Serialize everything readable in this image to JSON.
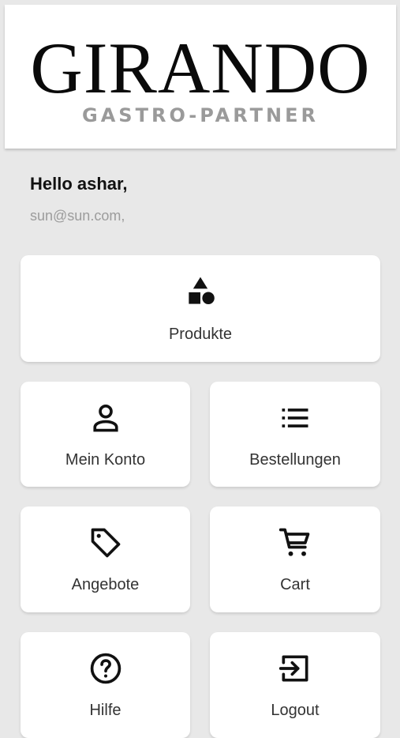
{
  "header": {
    "logo_main": "GIRANDO",
    "logo_sub": "GASTRO-PARTNER"
  },
  "user": {
    "greeting": "Hello ashar,",
    "email": "sun@sun.com,"
  },
  "menu": {
    "produkte": {
      "label": "Produkte",
      "icon": "shapes-icon"
    },
    "mein_konto": {
      "label": "Mein Konto",
      "icon": "person-icon"
    },
    "bestellungen": {
      "label": "Bestellungen",
      "icon": "list-icon"
    },
    "angebote": {
      "label": "Angebote",
      "icon": "tag-icon"
    },
    "cart": {
      "label": "Cart",
      "icon": "cart-icon"
    },
    "hilfe": {
      "label": "Hilfe",
      "icon": "help-icon"
    },
    "logout": {
      "label": "Logout",
      "icon": "logout-icon"
    }
  },
  "colors": {
    "background": "#e8e8e8",
    "card": "#ffffff",
    "text": "#333333",
    "muted": "#9c9c9c"
  }
}
